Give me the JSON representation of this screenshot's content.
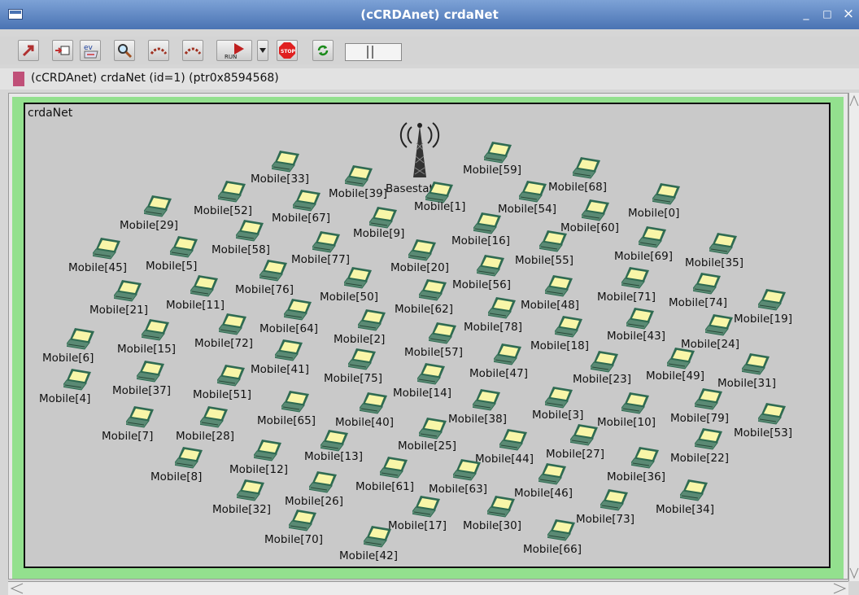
{
  "window": {
    "title": "(cCRDAnet) crdaNet",
    "minimize": "_",
    "maximize": "□",
    "close": "×"
  },
  "toolbar": {
    "run_label": "RUN",
    "stop_label": "STOP",
    "ev_label": "ev"
  },
  "info": {
    "text": "(cCRDAnet) crdaNet  (id=1)  (ptr0x8594568)"
  },
  "network": {
    "name": "crdaNet",
    "basestation_label": "Basestation",
    "mobiles": [
      {
        "id": "0",
        "label": "Mobile[0]"
      },
      {
        "id": "1",
        "label": "Mobile[1]"
      },
      {
        "id": "2",
        "label": "Mobile[2]"
      },
      {
        "id": "3",
        "label": "Mobile[3]"
      },
      {
        "id": "4",
        "label": "Mobile[4]"
      },
      {
        "id": "5",
        "label": "Mobile[5]"
      },
      {
        "id": "6",
        "label": "Mobile[6]"
      },
      {
        "id": "7",
        "label": "Mobile[7]"
      },
      {
        "id": "8",
        "label": "Mobile[8]"
      },
      {
        "id": "9",
        "label": "Mobile[9]"
      },
      {
        "id": "10",
        "label": "Mobile[10]"
      },
      {
        "id": "11",
        "label": "Mobile[11]"
      },
      {
        "id": "12",
        "label": "Mobile[12]"
      },
      {
        "id": "13",
        "label": "Mobile[13]"
      },
      {
        "id": "14",
        "label": "Mobile[14]"
      },
      {
        "id": "15",
        "label": "Mobile[15]"
      },
      {
        "id": "16",
        "label": "Mobile[16]"
      },
      {
        "id": "17",
        "label": "Mobile[17]"
      },
      {
        "id": "18",
        "label": "Mobile[18]"
      },
      {
        "id": "19",
        "label": "Mobile[19]"
      },
      {
        "id": "20",
        "label": "Mobile[20]"
      },
      {
        "id": "21",
        "label": "Mobile[21]"
      },
      {
        "id": "22",
        "label": "Mobile[22]"
      },
      {
        "id": "23",
        "label": "Mobile[23]"
      },
      {
        "id": "24",
        "label": "Mobile[24]"
      },
      {
        "id": "25",
        "label": "Mobile[25]"
      },
      {
        "id": "26",
        "label": "Mobile[26]"
      },
      {
        "id": "27",
        "label": "Mobile[27]"
      },
      {
        "id": "28",
        "label": "Mobile[28]"
      },
      {
        "id": "29",
        "label": "Mobile[29]"
      },
      {
        "id": "30",
        "label": "Mobile[30]"
      },
      {
        "id": "31",
        "label": "Mobile[31]"
      },
      {
        "id": "32",
        "label": "Mobile[32]"
      },
      {
        "id": "33",
        "label": "Mobile[33]"
      },
      {
        "id": "34",
        "label": "Mobile[34]"
      },
      {
        "id": "35",
        "label": "Mobile[35]"
      },
      {
        "id": "36",
        "label": "Mobile[36]"
      },
      {
        "id": "37",
        "label": "Mobile[37]"
      },
      {
        "id": "38",
        "label": "Mobile[38]"
      },
      {
        "id": "39",
        "label": "Mobile[39]"
      },
      {
        "id": "40",
        "label": "Mobile[40]"
      },
      {
        "id": "41",
        "label": "Mobile[41]"
      },
      {
        "id": "42",
        "label": "Mobile[42]"
      },
      {
        "id": "43",
        "label": "Mobile[43]"
      },
      {
        "id": "44",
        "label": "Mobile[44]"
      },
      {
        "id": "45",
        "label": "Mobile[45]"
      },
      {
        "id": "46",
        "label": "Mobile[46]"
      },
      {
        "id": "47",
        "label": "Mobile[47]"
      },
      {
        "id": "48",
        "label": "Mobile[48]"
      },
      {
        "id": "49",
        "label": "Mobile[49]"
      },
      {
        "id": "50",
        "label": "Mobile[50]"
      },
      {
        "id": "51",
        "label": "Mobile[51]"
      },
      {
        "id": "52",
        "label": "Mobile[52]"
      },
      {
        "id": "53",
        "label": "Mobile[53]"
      },
      {
        "id": "54",
        "label": "Mobile[54]"
      },
      {
        "id": "55",
        "label": "Mobile[55]"
      },
      {
        "id": "56",
        "label": "Mobile[56]"
      },
      {
        "id": "57",
        "label": "Mobile[57]"
      },
      {
        "id": "58",
        "label": "Mobile[58]"
      },
      {
        "id": "59",
        "label": "Mobile[59]"
      },
      {
        "id": "60",
        "label": "Mobile[60]"
      },
      {
        "id": "61",
        "label": "Mobile[61]"
      },
      {
        "id": "62",
        "label": "Mobile[62]"
      },
      {
        "id": "63",
        "label": "Mobile[63]"
      },
      {
        "id": "64",
        "label": "Mobile[64]"
      },
      {
        "id": "65",
        "label": "Mobile[65]"
      },
      {
        "id": "66",
        "label": "Mobile[66]"
      },
      {
        "id": "67",
        "label": "Mobile[67]"
      },
      {
        "id": "68",
        "label": "Mobile[68]"
      },
      {
        "id": "69",
        "label": "Mobile[69]"
      },
      {
        "id": "70",
        "label": "Mobile[70]"
      },
      {
        "id": "71",
        "label": "Mobile[71]"
      },
      {
        "id": "72",
        "label": "Mobile[72]"
      },
      {
        "id": "73",
        "label": "Mobile[73]"
      },
      {
        "id": "74",
        "label": "Mobile[74]"
      },
      {
        "id": "75",
        "label": "Mobile[75]"
      },
      {
        "id": "76",
        "label": "Mobile[76]"
      },
      {
        "id": "77",
        "label": "Mobile[77]"
      },
      {
        "id": "78",
        "label": "Mobile[78]"
      },
      {
        "id": "79",
        "label": "Mobile[79]"
      }
    ]
  },
  "colors": {
    "title_bar": "#5a82c0",
    "canvas_border": "#93e08e",
    "network_bg": "#c9c9c9",
    "laptop_screen": "#f8f6a8",
    "laptop_body": "#2f6b52"
  }
}
